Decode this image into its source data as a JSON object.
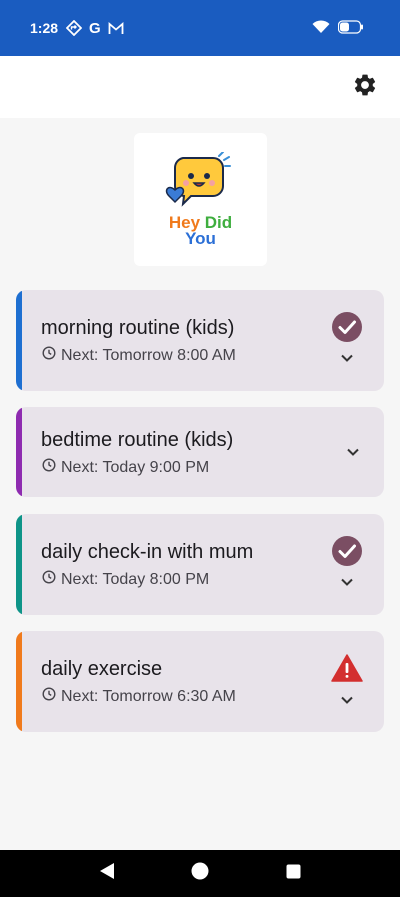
{
  "status_bar": {
    "time": "1:28",
    "icons": [
      "location-diamond-icon",
      "google-g-icon",
      "gmail-icon",
      "wifi-icon",
      "battery-icon"
    ],
    "g_label": "G"
  },
  "app_bar": {
    "settings_icon": "gear-icon"
  },
  "logo": {
    "word1": "Hey",
    "word2": "Did",
    "word3": "You"
  },
  "routines": [
    {
      "title": "morning routine (kids)",
      "next": "Next: Tomorrow 8:00 AM",
      "accent": "#1e6fd1",
      "status": "completed"
    },
    {
      "title": "bedtime routine (kids)",
      "next": "Next: Today 9:00 PM",
      "accent": "#8e2bb0",
      "status": "none"
    },
    {
      "title": "daily check-in with mum",
      "next": "Next: Today 8:00 PM",
      "accent": "#0e9488",
      "status": "completed"
    },
    {
      "title": "daily exercise",
      "next": "Next: Tomorrow 6:30 AM",
      "accent": "#f07a1c",
      "status": "warning"
    }
  ],
  "colors": {
    "check_circle": "#7b4e63",
    "warning": "#d32f2f",
    "card_bg": "#e8e3ea",
    "status_bar": "#1a5cc0"
  },
  "nav": [
    "back-icon",
    "home-icon",
    "recents-icon"
  ]
}
